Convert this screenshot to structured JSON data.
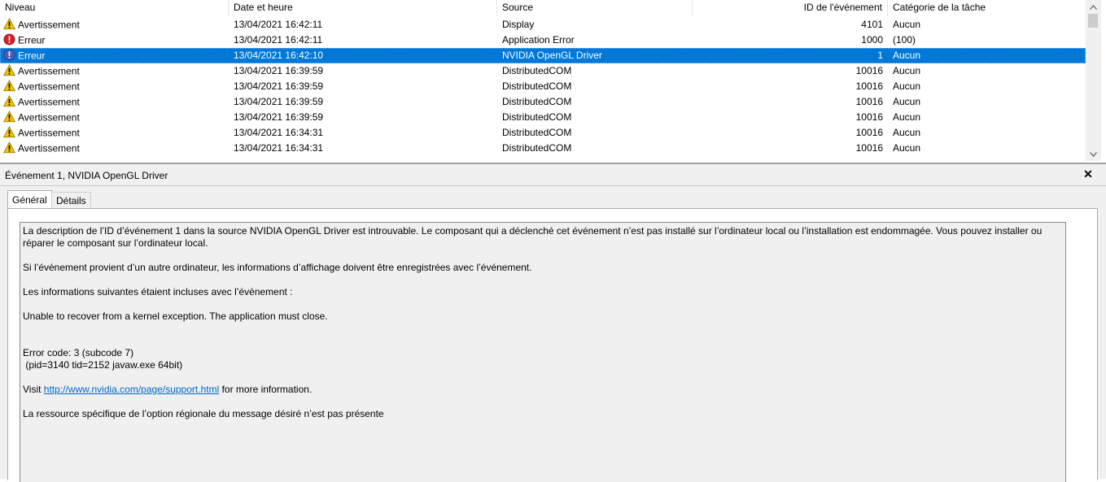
{
  "columns": {
    "level": "Niveau",
    "date": "Date et heure",
    "source": "Source",
    "event_id": "ID de l'événement",
    "category": "Catégorie de la tâche"
  },
  "events": [
    {
      "level": "Avertissement",
      "type": "warning",
      "date": "13/04/2021 16:42:11",
      "source": "Display",
      "id": "4101",
      "category": "Aucun"
    },
    {
      "level": "Erreur",
      "type": "error",
      "date": "13/04/2021 16:42:11",
      "source": "Application Error",
      "id": "1000",
      "category": "(100)"
    },
    {
      "level": "Erreur",
      "type": "error",
      "date": "13/04/2021 16:42:10",
      "source": "NVIDIA OpenGL Driver",
      "id": "1",
      "category": "Aucun",
      "selected": true
    },
    {
      "level": "Avertissement",
      "type": "warning",
      "date": "13/04/2021 16:39:59",
      "source": "DistributedCOM",
      "id": "10016",
      "category": "Aucun"
    },
    {
      "level": "Avertissement",
      "type": "warning",
      "date": "13/04/2021 16:39:59",
      "source": "DistributedCOM",
      "id": "10016",
      "category": "Aucun"
    },
    {
      "level": "Avertissement",
      "type": "warning",
      "date": "13/04/2021 16:39:59",
      "source": "DistributedCOM",
      "id": "10016",
      "category": "Aucun"
    },
    {
      "level": "Avertissement",
      "type": "warning",
      "date": "13/04/2021 16:39:59",
      "source": "DistributedCOM",
      "id": "10016",
      "category": "Aucun"
    },
    {
      "level": "Avertissement",
      "type": "warning",
      "date": "13/04/2021 16:34:31",
      "source": "DistributedCOM",
      "id": "10016",
      "category": "Aucun"
    },
    {
      "level": "Avertissement",
      "type": "warning",
      "date": "13/04/2021 16:34:31",
      "source": "DistributedCOM",
      "id": "10016",
      "category": "Aucun"
    }
  ],
  "details": {
    "title": "Événement 1, NVIDIA OpenGL Driver",
    "close_label": "✕",
    "tabs": [
      "Général",
      "Détails"
    ],
    "paragraphs": {
      "p1": "La description de l’ID d’événement 1 dans la source NVIDIA OpenGL Driver est introuvable. Le composant qui a déclenché cet événement n’est pas installé sur l’ordinateur local ou l’installation est endommagée. Vous pouvez installer ou réparer le composant sur l’ordinateur local.",
      "p2": "Si l’événement provient d’un autre ordinateur, les informations d’affichage doivent être enregistrées avec l’événement.",
      "p3": "Les informations suivantes étaient incluses avec l’événement :",
      "p4": "Unable to recover from a kernel exception. The application must close.",
      "p5a": "Error code: 3 (subcode 7)",
      "p5b": " (pid=3140 tid=2152 javaw.exe 64bit)",
      "visit_prefix": "Visit ",
      "visit_link": "http://www.nvidia.com/page/support.html",
      "visit_suffix": " for more information.",
      "p7": "La ressource spécifique de l’option régionale du message désiré n’est pas présente"
    }
  },
  "colors": {
    "selection": "#0078d7",
    "warning": "#f5c400",
    "error": "#d4222a",
    "link": "#0066cc"
  }
}
